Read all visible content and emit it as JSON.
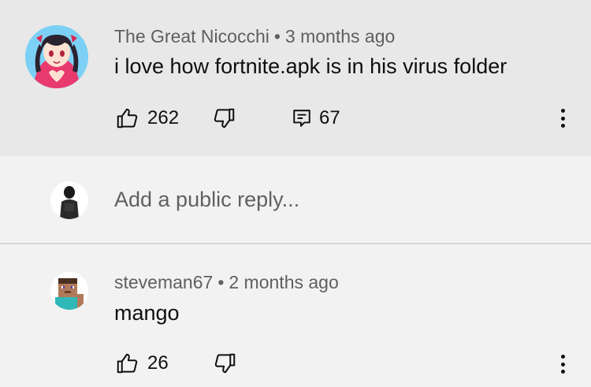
{
  "comment": {
    "author": "The Great Nicocchi",
    "time": "3 months ago",
    "text": "i love how fortnite.apk is in his virus folder",
    "likes": "262",
    "replies": "67"
  },
  "reply_input": {
    "placeholder": "Add a public reply..."
  },
  "reply": {
    "author": "steveman67",
    "time": "2 months ago",
    "text": "mango",
    "likes": "26"
  },
  "icons": {
    "like": "thumbs-up-icon",
    "dislike": "thumbs-down-icon",
    "replies": "comment-icon",
    "more": "more-vertical-icon"
  },
  "colors": {
    "top_bg": "#e8e8e8",
    "page_bg": "#f2f2f2",
    "text": "#0f0f0f",
    "secondary_text": "#606060"
  }
}
